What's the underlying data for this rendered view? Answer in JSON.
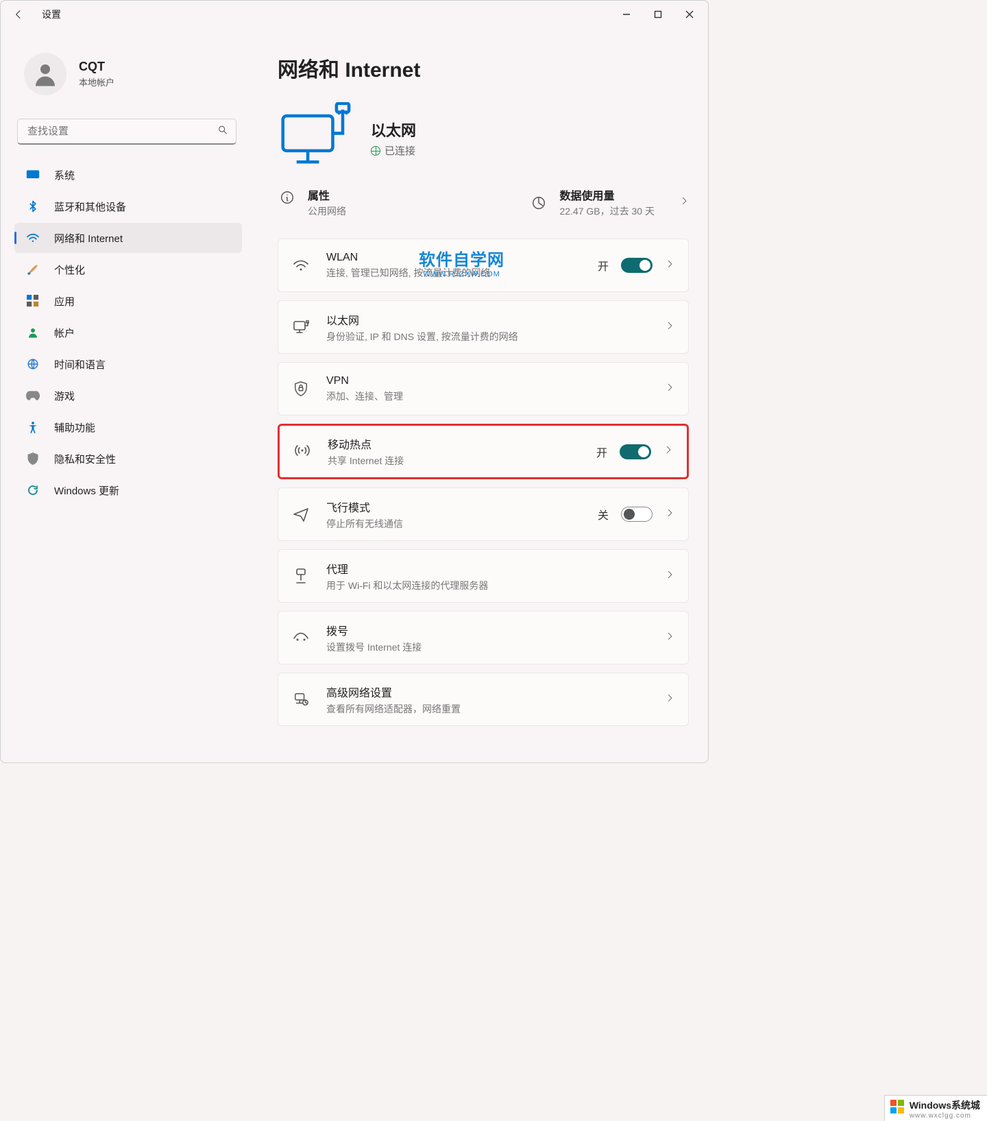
{
  "app_title": "设置",
  "user": {
    "name": "CQT",
    "subtitle": "本地帐户"
  },
  "search": {
    "placeholder": "查找设置"
  },
  "nav": [
    {
      "label": "系统"
    },
    {
      "label": "蓝牙和其他设备"
    },
    {
      "label": "网络和 Internet"
    },
    {
      "label": "个性化"
    },
    {
      "label": "应用"
    },
    {
      "label": "帐户"
    },
    {
      "label": "时间和语言"
    },
    {
      "label": "游戏"
    },
    {
      "label": "辅助功能"
    },
    {
      "label": "隐私和安全性"
    },
    {
      "label": "Windows 更新"
    }
  ],
  "page_title": "网络和 Internet",
  "connection": {
    "name": "以太网",
    "status": "已连接"
  },
  "quicklinks": {
    "props": {
      "title": "属性",
      "sub": "公用网络"
    },
    "usage": {
      "title": "数据使用量",
      "sub": "22.47 GB，过去 30 天"
    }
  },
  "cards": {
    "wlan": {
      "title": "WLAN",
      "sub": "连接, 管理已知网络, 按流量计费的网络",
      "state": "开"
    },
    "ethernet": {
      "title": "以太网",
      "sub": "身份验证, IP 和 DNS 设置, 按流量计费的网络"
    },
    "vpn": {
      "title": "VPN",
      "sub": "添加、连接、管理"
    },
    "hotspot": {
      "title": "移动热点",
      "sub": "共享 Internet 连接",
      "state": "开"
    },
    "airplane": {
      "title": "飞行模式",
      "sub": "停止所有无线通信",
      "state": "关"
    },
    "proxy": {
      "title": "代理",
      "sub": "用于 Wi-Fi 和以太网连接的代理服务器"
    },
    "dialup": {
      "title": "拨号",
      "sub": "设置拨号 Internet 连接"
    },
    "advanced": {
      "title": "高级网络设置",
      "sub": "查看所有网络适配器，网络重置"
    }
  },
  "watermark": {
    "main": "软件自学网",
    "sub": "WWW.RJZXW.COM"
  },
  "footer": {
    "line1": "Windows系统城",
    "line2": "www.wxclgg.com"
  }
}
